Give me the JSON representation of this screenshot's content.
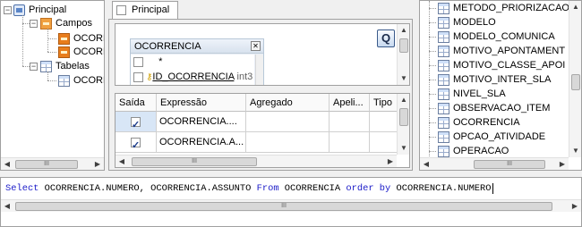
{
  "tree": {
    "root_label": "Principal",
    "campos_label": "Campos",
    "campo_items": [
      "OCORRENCIA.N",
      "OCORRENCIA.A"
    ],
    "tabelas_label": "Tabelas",
    "tabela_items": [
      "OCORRENCIA"
    ]
  },
  "designer": {
    "tab_label": "Principal",
    "table_box": {
      "title": "OCORRENCIA",
      "fields": [
        {
          "name": "*",
          "type": ""
        },
        {
          "name": "ID_OCORRENCIA",
          "type": "int3"
        }
      ]
    },
    "query_button": "Q"
  },
  "grid": {
    "headers": [
      "Saída",
      "Expressão",
      "Agregado",
      "Apeli...",
      "Tipo"
    ],
    "rows": [
      {
        "checked": true,
        "expression": "OCORRENCIA...."
      },
      {
        "checked": true,
        "expression": "OCORRENCIA.A..."
      }
    ]
  },
  "table_list": {
    "items": [
      "METODO_PRIORIZACAO",
      "MODELO",
      "MODELO_COMUNICA",
      "MOTIVO_APONTAMENT",
      "MOTIVO_CLASSE_APOI",
      "MOTIVO_INTER_SLA",
      "NIVEL_SLA",
      "OBSERVACAO_ITEM",
      "OCORRENCIA",
      "OPCAO_ATIVIDADE",
      "OPERACAO"
    ]
  },
  "sql": {
    "kw_select": "Select",
    "fields": " OCORRENCIA.NUMERO, OCORRENCIA.ASSUNTO ",
    "kw_from": "From",
    "table": " OCORRENCIA ",
    "kw_order": "order by",
    "order_field": " OCORRENCIA.NUMERO"
  },
  "colors": {
    "keyword": "#1a1ac8",
    "border": "#a0a0a0"
  }
}
